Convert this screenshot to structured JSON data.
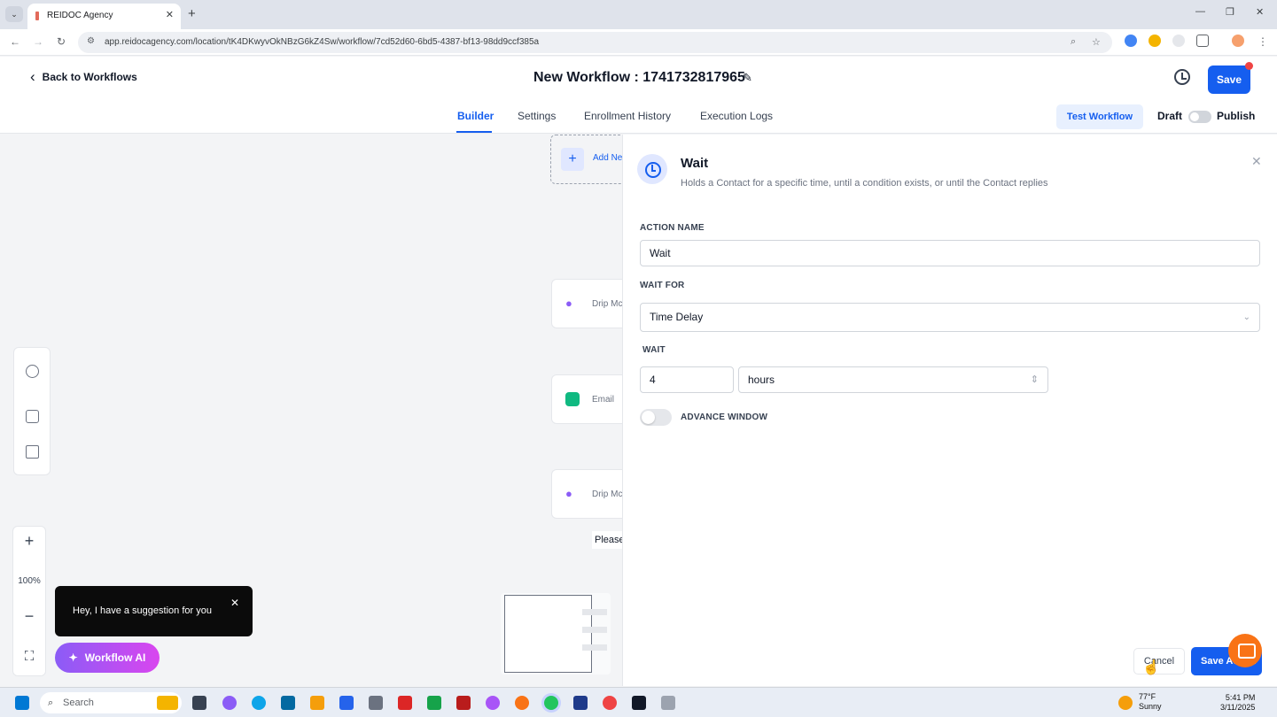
{
  "browser": {
    "tab_title": "REIDOC Agency",
    "tab_close": "✕",
    "new_tab": "+",
    "url": "app.reidocagency.com/location/tK4DKwyvOkNBzG6kZ4Sw/workflow/7cd52d60-6bd5-4387-bf13-98dd9ccf385a",
    "window_minimize": "—",
    "window_restore": "❐",
    "window_close": "✕"
  },
  "header": {
    "back_label": "Back to Workflows",
    "title": "New Workflow : 1741732817965",
    "save_label": "Save"
  },
  "subnav": {
    "tabs": [
      "Builder",
      "Settings",
      "Enrollment History",
      "Execution Logs"
    ],
    "active_tab": "Builder",
    "test_workflow": "Test Workflow",
    "draft": "Draft",
    "publish": "Publish"
  },
  "canvas": {
    "add_node_label": "Add Ne",
    "nodes": [
      {
        "label": "Drip Mc",
        "icon": "drop-icon",
        "color": "#8b5cf6"
      },
      {
        "label": "Email",
        "icon": "email-icon",
        "color": "#10b981"
      },
      {
        "label": "Drip Mc",
        "icon": "drop-icon",
        "color": "#8b5cf6"
      }
    ],
    "please_text": "Please",
    "zoom_in": "+",
    "zoom_level": "100%",
    "zoom_out": "−",
    "fit_icon": "⛶",
    "suggestion_text": "Hey, I have a suggestion for you",
    "suggestion_close": "✕",
    "ai_button": "Workflow AI"
  },
  "panel": {
    "title": "Wait",
    "description": "Holds a Contact for a specific time, until a condition exists, or until the Contact replies",
    "close": "✕",
    "action_name_label": "ACTION NAME",
    "action_name_value": "Wait",
    "wait_for_label": "WAIT FOR",
    "wait_for_value": "Time Delay",
    "wait_label": "WAIT",
    "wait_amount": "4",
    "wait_unit": "hours",
    "advance_window_label": "ADVANCE WINDOW",
    "advance_window_on": false,
    "cancel": "Cancel",
    "save_action": "Save Action"
  },
  "taskbar": {
    "search_placeholder": "Search",
    "weather_temp": "77°F",
    "weather_desc": "Sunny",
    "time": "5:41 PM",
    "date": "3/11/2025"
  },
  "colors": {
    "primary": "#155eef",
    "ai_gradient_start": "#8b5cf6",
    "ai_gradient_end": "#d946ef",
    "chat_orange": "#f97316"
  }
}
